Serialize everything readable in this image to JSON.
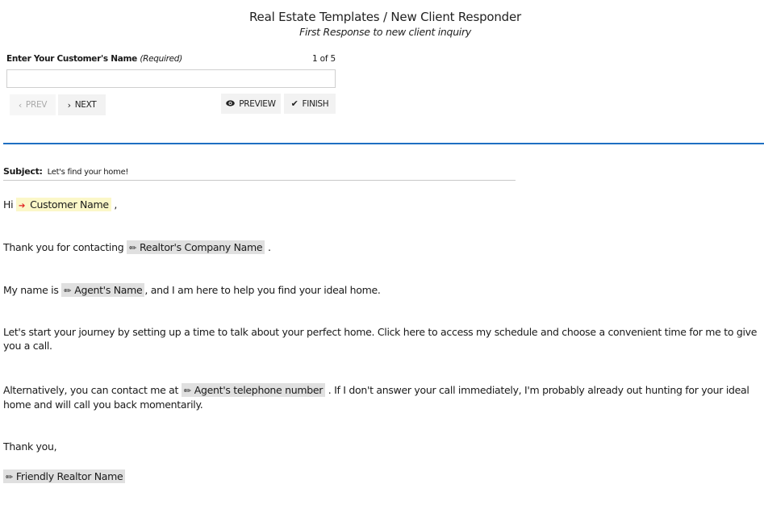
{
  "header": {
    "title": "Real Estate Templates / New Client Responder",
    "subtitle": "First Response to new client inquiry"
  },
  "field": {
    "label": "Enter Your Customer's Name",
    "required_note": "(Required)",
    "counter": "1 of 5",
    "value": "",
    "placeholder": ""
  },
  "toolbar": {
    "prev_label": "PREV",
    "next_label": "NEXT",
    "preview_label": "PREVIEW",
    "finish_label": "FINISH",
    "prev_icon": "chevron-left-icon",
    "next_icon": "chevron-right-icon",
    "preview_icon": "eye-icon",
    "finish_icon": "check-icon"
  },
  "colors": {
    "accent_divider": "#1f6fc2",
    "required_token_bg": "#fbf7c8",
    "token_bg": "#e0e0e0",
    "required_arrow": "#e02020"
  },
  "email": {
    "subject_label": "Subject:",
    "subject": "Let's find your home!",
    "greeting": {
      "prefix": "Hi",
      "token": "Customer Name",
      "suffix": ","
    },
    "p1": {
      "prefix": "Thank you for contacting",
      "token": "Realtor's Company Name",
      "suffix": "."
    },
    "p2": {
      "prefix": "My name is",
      "token": "Agent's Name",
      "suffix": ", and I am here to help you find your ideal home."
    },
    "p3": "Let's start your journey by setting up a time to talk about your perfect home. Click here to access my schedule and choose a convenient time for me to give you a call.",
    "p4": {
      "prefix": "Alternatively, you can contact me at",
      "token": "Agent's telephone number",
      "suffix": ". If I don't answer your call immediately, I'm probably already out hunting for your ideal home and will call you back momentarily."
    },
    "closing": "Thank you,",
    "signature_token": "Friendly Realtor Name"
  }
}
